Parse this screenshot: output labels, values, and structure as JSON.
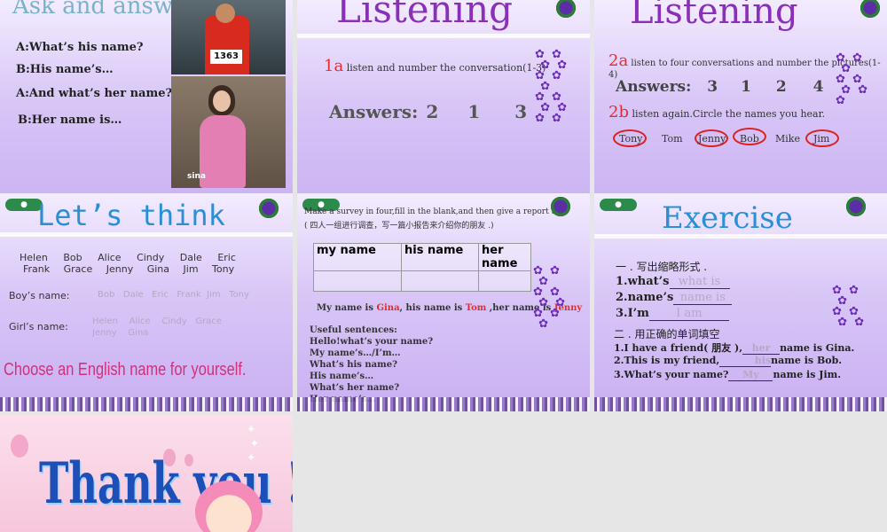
{
  "slide1": {
    "title": "Ask and answer",
    "lines": [
      "A:What’s his name?",
      "B:His  name’s…",
      "A:And what’s her name?",
      "B:Her name is…"
    ],
    "bib": "1363",
    "photo_caption": "sina"
  },
  "slide2": {
    "title": "Listening",
    "task_num": "1a",
    "task_text": "listen and number the conversation(1-3)",
    "answers_label": "Answers:",
    "answers": [
      "2",
      "1",
      "3"
    ]
  },
  "slide3": {
    "title": "Listening",
    "task_a_num": "2a",
    "task_a_text": "listen to four conversations and number the pictures(1-4)",
    "answers_label": "Answers:",
    "answers": [
      "3",
      "1",
      "2",
      "4"
    ],
    "task_b_num": "2b",
    "task_b_text": "listen again.Circle the names you hear.",
    "names": [
      "Tony",
      "Tom",
      "Jenny",
      "Bob",
      "Mike",
      "Jim"
    ]
  },
  "slide4": {
    "title": "Let’s  think",
    "names_row1": [
      "Helen",
      "Bob",
      "Alice",
      "Cindy",
      "Dale",
      "Eric"
    ],
    "names_row2": [
      "Frank",
      "Grace",
      "Jenny",
      "Gina",
      "Jim",
      "Tony"
    ],
    "boys_label": "Boy’s name:",
    "boys": "Bob   Dale   Eric   Frank  Jim   Tony",
    "girls_label": "Girl’s name:",
    "girls_row1": "Helen    Alice    Cindy   Grace",
    "girls_row2": "Jenny    Gina",
    "choose": "Choose an English name for yourself."
  },
  "slide5": {
    "instruction": "Make a survey in four,fill in the blank,and then give a report to",
    "instruction_cn": "( 四人一组进行调查，写一篇小报告来介绍你的朋友 .)",
    "headers": [
      "my name",
      "his name",
      "her name"
    ],
    "row_values": [
      "Gina",
      "Tom",
      "Jenny"
    ],
    "report_pre": "My name is ",
    "report_mid1": ", his name is ",
    "report_mid2": " ,her name is ",
    "useful_label": "Useful sentences:",
    "sentences": [
      "Hello!what’s your name?",
      "My name’s…/I’m…",
      "What’s his name?",
      "His name’s…",
      "What’s her name?",
      "Her name’s…"
    ]
  },
  "slide6": {
    "title": "Exercise",
    "part1": "一 . 写出缩略形式 .",
    "items1": [
      {
        "label": "1.what’s",
        "answer": "what is"
      },
      {
        "label": "2.name’s",
        "answer": "name is"
      },
      {
        "label": "3.I’m",
        "answer": "I am"
      }
    ],
    "part2": "二 . 用正确的单词填空",
    "items2": [
      {
        "pre": "1.I have a friend( 朋友 ),",
        "answer": "her",
        "post": "name is Gina."
      },
      {
        "pre": "2.This is my friend,",
        "answer": "his",
        "post": "name is  Bob."
      },
      {
        "pre": "3.What’s your name?",
        "answer": "My",
        "post": "name is Jim."
      }
    ]
  },
  "slide7": {
    "thanks": "Thank you !"
  },
  "colors": {
    "purple": "#8a2fb8",
    "red": "#e52c2c",
    "answer_gray": "#b5a8c5"
  }
}
